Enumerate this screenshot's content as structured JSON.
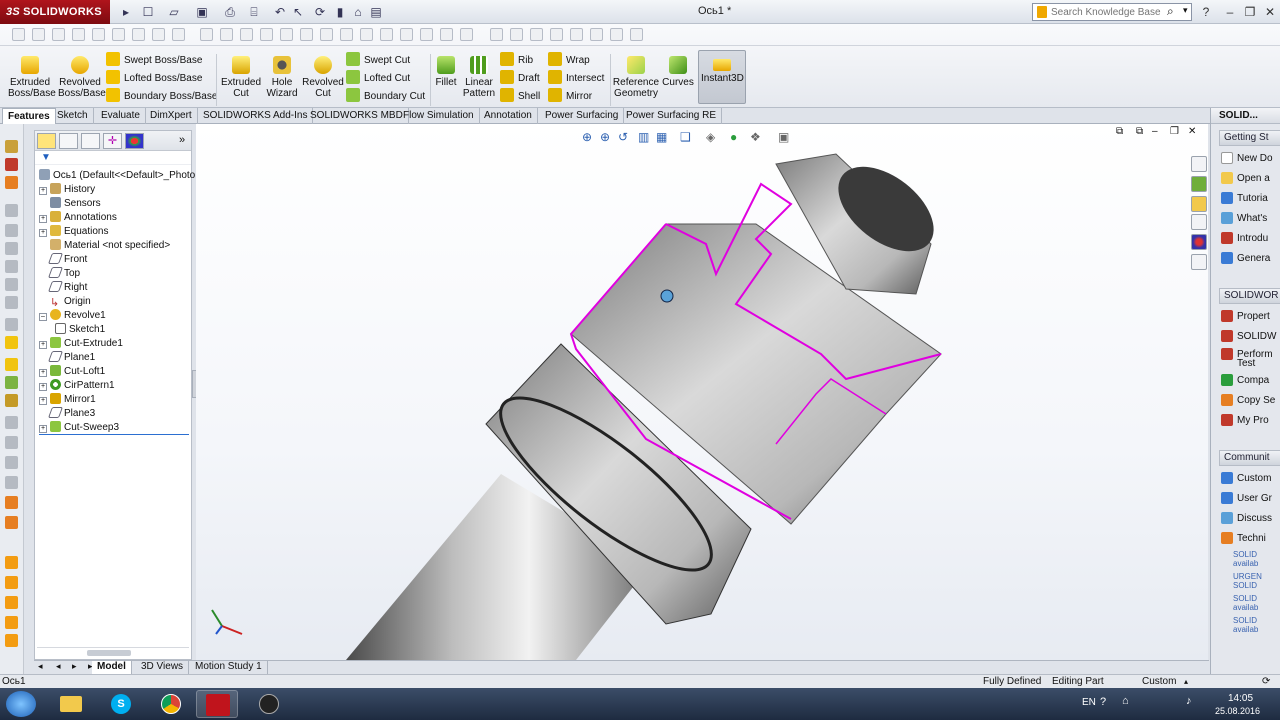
{
  "app": {
    "brand": "SOLIDWORKS",
    "brand_prefix": "3S",
    "document_title": "Ось1 *",
    "search_placeholder": "Search Knowledge Base",
    "accent": "#b0141c"
  },
  "ribbon": {
    "big_tools": [
      {
        "label1": "Extruded",
        "label2": "Boss/Base"
      },
      {
        "label1": "Revolved",
        "label2": "Boss/Base"
      },
      {
        "label1": "Extruded",
        "label2": "Cut"
      },
      {
        "label1": "Hole",
        "label2": "Wizard"
      },
      {
        "label1": "Revolved",
        "label2": "Cut"
      },
      {
        "label1": "Fillet",
        "label2": ""
      },
      {
        "label1": "Linear",
        "label2": "Pattern"
      },
      {
        "label1": "Reference",
        "label2": "Geometry"
      },
      {
        "label1": "Curves",
        "label2": ""
      },
      {
        "label1": "Instant3D",
        "label2": ""
      }
    ],
    "boss_tools": [
      "Swept Boss/Base",
      "Lofted Boss/Base",
      "Boundary Boss/Base"
    ],
    "cut_tools": [
      "Swept Cut",
      "Lofted Cut",
      "Boundary Cut"
    ],
    "feature_tools": [
      "Rib",
      "Draft",
      "Shell"
    ],
    "misc_tools": [
      "Wrap",
      "Intersect",
      "Mirror"
    ]
  },
  "tabs": [
    "Features",
    "Sketch",
    "Evaluate",
    "DimXpert",
    "SOLIDWORKS Add-Ins",
    "SOLIDWORKS MBD",
    "Flow Simulation",
    "Annotation",
    "Power Surfacing",
    "Power Surfacing RE"
  ],
  "tree": {
    "root": "Ось1  (Default<<Default>_Photo",
    "items": [
      "History",
      "Sensors",
      "Annotations",
      "Equations",
      "Material <not specified>",
      "Front",
      "Top",
      "Right",
      "Origin",
      "Revolve1",
      "Sketch1",
      "Cut-Extrude1",
      "Plane1",
      "Cut-Loft1",
      "CirPattern1",
      "Mirror1",
      "Plane3",
      "Cut-Sweep3"
    ]
  },
  "bottom_tabs": [
    "Model",
    "3D Views",
    "Motion Study 1"
  ],
  "task_pane": {
    "header": "SOLID...",
    "getting_started": "Getting St",
    "getting_items": [
      "New Do",
      "Open a",
      "Tutoria",
      "What's",
      "Introdu",
      "Genera"
    ],
    "solidworks_section": "SOLIDWOR",
    "sw_items": [
      "Propert",
      "SOLIDW",
      "Perform",
      "Compa",
      "Copy Se",
      "My Pro"
    ],
    "sw_items_sub": "Test",
    "community_section": "Communit",
    "community_items": [
      "Custom",
      "User Gr",
      "Discuss",
      "Techni"
    ],
    "news": [
      "SOLID",
      "availab",
      "URGEN",
      "SOLID",
      "SOLID",
      "availab",
      "SOLID",
      "availab"
    ]
  },
  "status": {
    "left": "Ось1",
    "state": "Fully Defined",
    "mode": "Editing Part",
    "units": "Custom"
  },
  "taskbar": {
    "lang": "EN",
    "time": "14:05",
    "date": "25.08.2016"
  }
}
